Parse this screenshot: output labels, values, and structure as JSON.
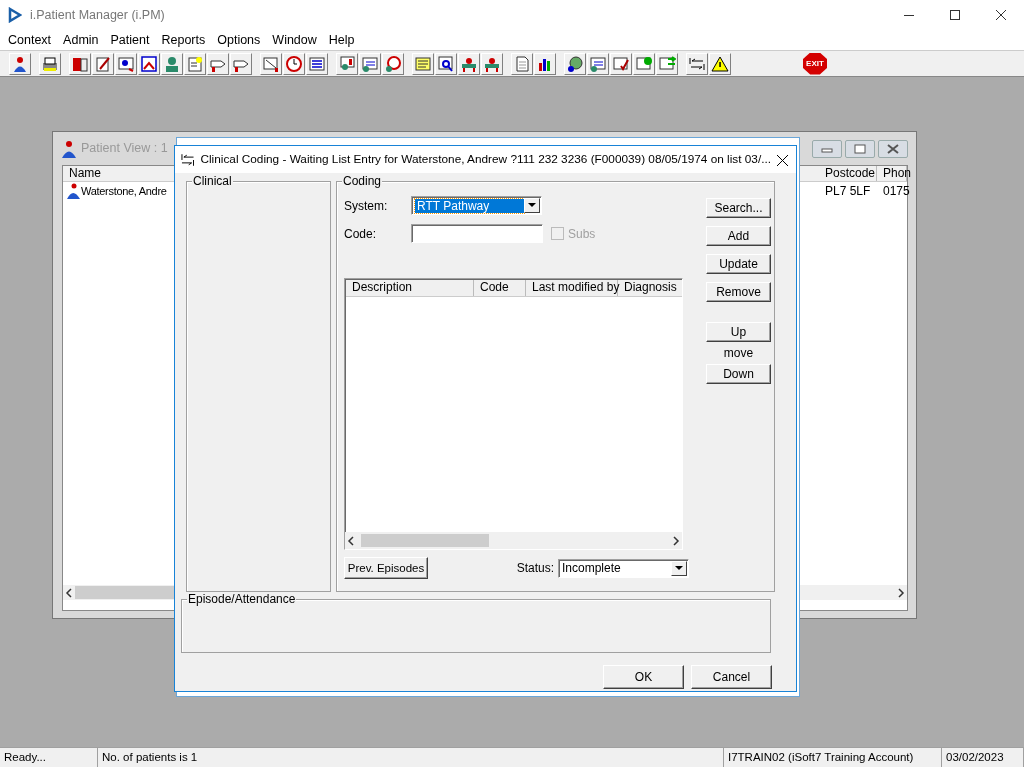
{
  "app": {
    "title": "i.Patient Manager (i.PM)"
  },
  "menu": [
    {
      "label": "Context"
    },
    {
      "label": "Admin"
    },
    {
      "label": "Patient"
    },
    {
      "label": "Reports"
    },
    {
      "label": "Options"
    },
    {
      "label": "Window"
    },
    {
      "label": "Help"
    }
  ],
  "toolbar": {
    "exit_label": "EXIT"
  },
  "patient_view": {
    "title": "Patient View : 1",
    "columns": [
      {
        "label": "Name"
      },
      {
        "label": "Postcode"
      },
      {
        "label": "Phon"
      }
    ],
    "rows": [
      {
        "cells": [
          "Waterstone, Andre",
          "PL7 5LF",
          "0175"
        ]
      }
    ]
  },
  "dialog": {
    "title": "Clinical Coding - Waiting List Entry for Waterstone, Andrew ?111 232 3236 (F000039) 08/05/1974 on list 03/...",
    "clinical_group": "Clinical",
    "coding_group": "Coding",
    "system": {
      "label": "System:",
      "value": "RTT Pathway",
      "focused": true
    },
    "code": {
      "label": "Code:"
    },
    "subs": {
      "label": "Subs",
      "checked": false,
      "disabled": true
    },
    "list_columns": [
      {
        "label": "Description"
      },
      {
        "label": "Code"
      },
      {
        "label": "Last modified by"
      },
      {
        "label": "Diagnosis"
      }
    ],
    "side_buttons": [
      {
        "label": "Search..."
      },
      {
        "label": "Add"
      },
      {
        "label": "Update"
      },
      {
        "label": "Remove"
      }
    ],
    "move_buttons": [
      {
        "kind": "button",
        "label": "Up"
      },
      {
        "kind": "label",
        "label": "move"
      },
      {
        "kind": "button",
        "label": "Down"
      }
    ],
    "prev_button": "Prev. Episodes",
    "status": {
      "label": "Status:",
      "value": "Incomplete"
    },
    "episode_group": "Episode/Attendance",
    "footer_buttons": [
      {
        "label": "OK"
      },
      {
        "label": "Cancel"
      }
    ]
  },
  "status_bar": [
    {
      "text": "Ready..."
    },
    {
      "text": "No. of patients is 1"
    },
    {
      "text": "I7TRAIN02 (iSoft7 Training Account)"
    },
    {
      "text": "03/02/2023"
    }
  ]
}
